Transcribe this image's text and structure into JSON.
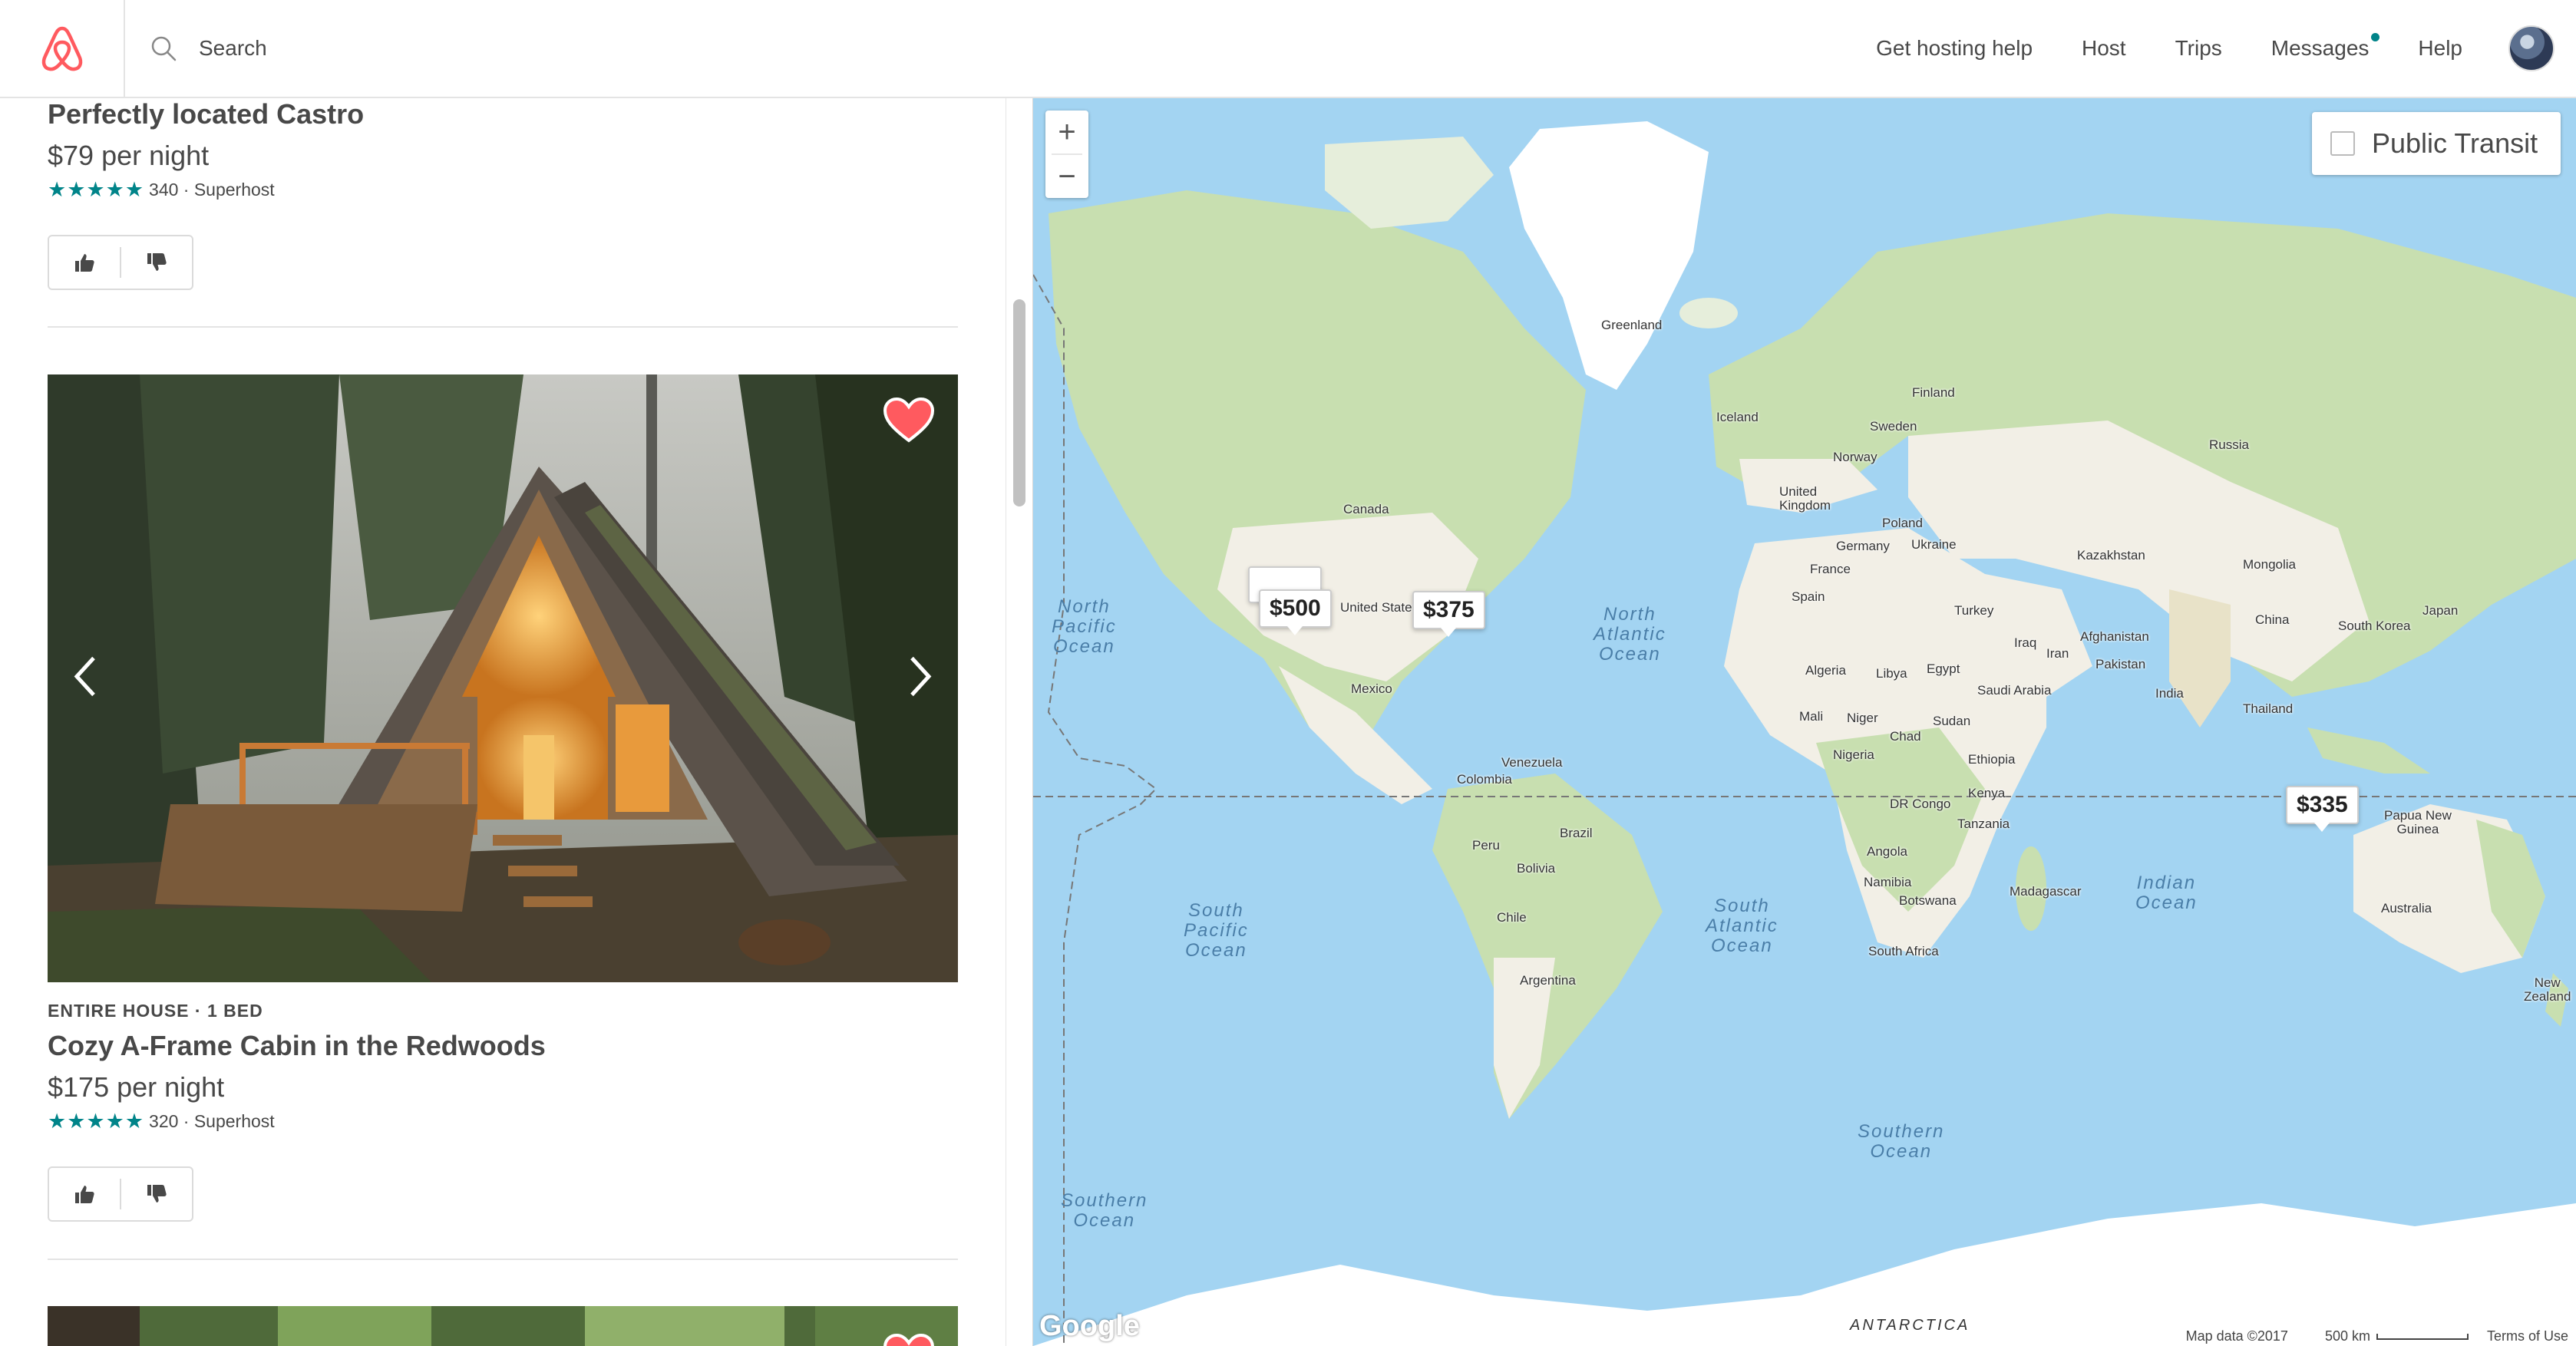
{
  "header": {
    "search_placeholder": "Search",
    "nav": {
      "get_hosting_help": "Get hosting help",
      "host": "Host",
      "trips": "Trips",
      "messages": "Messages",
      "help": "Help"
    }
  },
  "listings": [
    {
      "title": "Perfectly located Castro",
      "price": "$79 per night",
      "stars": "★★★★★",
      "rating_text": "340 · Superhost"
    },
    {
      "kicker": "ENTIRE HOUSE · 1 BED",
      "title": "Cozy A-Frame Cabin in the Redwoods",
      "price": "$175 per night",
      "stars": "★★★★★",
      "rating_text": "320 · Superhost"
    }
  ],
  "map": {
    "public_transit_label": "Public Transit",
    "zoom_in": "+",
    "zoom_out": "−",
    "price_pins": [
      "$500",
      "$375",
      "$335"
    ],
    "labels": {
      "greenland": "Greenland",
      "iceland": "Iceland",
      "finland": "Finland",
      "sweden": "Sweden",
      "norway": "Norway",
      "russia": "Russia",
      "uk": "United\nKingdom",
      "poland": "Poland",
      "germany": "Germany",
      "ukraine": "Ukraine",
      "france": "France",
      "spain": "Spain",
      "kazakhstan": "Kazakhstan",
      "mongolia": "Mongolia",
      "turkey": "Turkey",
      "canada": "Canada",
      "united_states": "United States",
      "mexico": "Mexico",
      "china": "China",
      "japan": "Japan",
      "south_korea": "South Korea",
      "afghanistan": "Afghanistan",
      "iraq": "Iraq",
      "iran": "Iran",
      "pakistan": "Pakistan",
      "algeria": "Algeria",
      "libya": "Libya",
      "egypt": "Egypt",
      "saudi_arabia": "Saudi Arabia",
      "india": "India",
      "thailand": "Thailand",
      "mali": "Mali",
      "niger": "Niger",
      "chad": "Chad",
      "sudan": "Sudan",
      "nigeria": "Nigeria",
      "ethiopia": "Ethiopia",
      "venezuela": "Venezuela",
      "colombia": "Colombia",
      "kenya": "Kenya",
      "dr_congo": "DR Congo",
      "tanzania": "Tanzania",
      "papua": "Papua New\nGuinea",
      "peru": "Peru",
      "brazil": "Brazil",
      "bolivia": "Bolivia",
      "angola": "Angola",
      "namibia": "Namibia",
      "botswana": "Botswana",
      "madagascar": "Madagascar",
      "australia": "Australia",
      "chile": "Chile",
      "argentina": "Argentina",
      "south_africa": "South Africa",
      "new_zealand": "New\nZealand",
      "antarctica": "ANTARCTICA"
    },
    "oceans": {
      "north_pacific": "North\nPacific\nOcean",
      "north_atlantic": "North\nAtlantic\nOcean",
      "south_pacific": "South\nPacific\nOcean",
      "south_atlantic": "South\nAtlantic\nOcean",
      "indian": "Indian\nOcean",
      "southern_1": "Southern\nOcean",
      "southern_2": "Southern\nOcean"
    },
    "google": "Google",
    "attribution": {
      "map_data": "Map data ©2017",
      "scale": "500 km",
      "terms": "Terms of Use"
    }
  },
  "colors": {
    "brand": "#FF5A5F",
    "teal": "#008489",
    "water": "#A3D4F2",
    "land": "#F2EFE6",
    "vegetation": "#C8DFB0"
  }
}
